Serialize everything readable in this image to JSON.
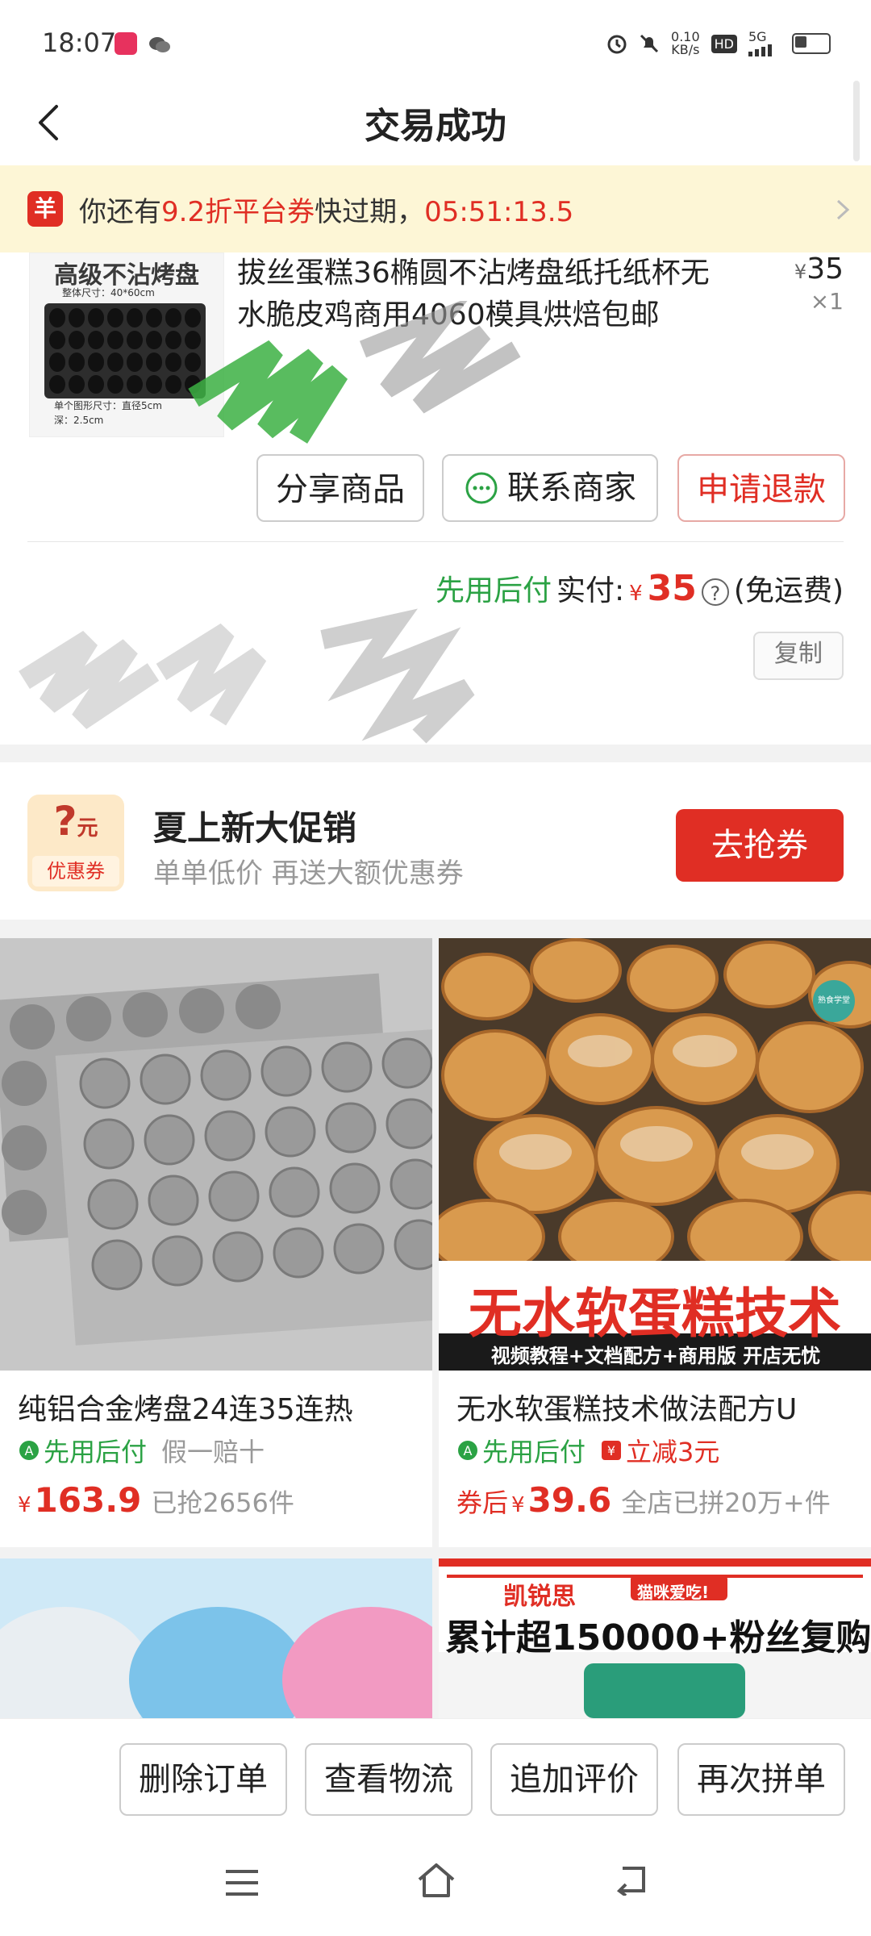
{
  "status_bar": {
    "time": "18:07",
    "net_speed": "0.10",
    "net_unit": "KB/s",
    "hd": "HD",
    "signal": "5G"
  },
  "header": {
    "title": "交易成功"
  },
  "coupon_banner": {
    "badge": "羊",
    "pre": "你还有",
    "highlight": "9.2折平台券",
    "mid": "快过期，",
    "countdown": "05:51:13.5"
  },
  "order": {
    "thumb_title": "高级不沾烤盘",
    "thumb_size": "整体尺寸：40*60cm",
    "thumb_dim1": "单个图形尺寸：直径5cm",
    "thumb_dim2": "深：2.5cm",
    "product_name": "拔丝蛋糕36椭圆不沾烤盘纸托纸杯无水脆皮鸡商用4060模具烘焙包邮",
    "price_symbol": "¥",
    "price": "35",
    "quantity": "×1",
    "buttons": {
      "share": "分享商品",
      "contact": "联系商家",
      "refund": "申请退款"
    },
    "pay_tag": "先用后付",
    "paid_label": "实付:",
    "paid_symbol": "¥",
    "paid_amount": "35",
    "shipping": "(免运费)",
    "copy": "复制"
  },
  "promo": {
    "icon_q": "?",
    "icon_unit": "元",
    "icon_label": "优惠券",
    "title": "夏上新大促销",
    "subtitle": "单单低价 再送大额优惠券",
    "button": "去抢券"
  },
  "products": [
    {
      "name": "纯铝合金烤盘24连35连热",
      "tag1": "先用后付",
      "tag2": "假一赔十",
      "price_prefix": "",
      "price_symbol": "¥",
      "price": "163.9",
      "sold": "已抢2656件"
    },
    {
      "name": "无水软蛋糕技术做法配方U",
      "tag1": "先用后付",
      "tag2": "立减3元",
      "price_prefix": "券后",
      "price_symbol": "¥",
      "price": "39.6",
      "sold": "全店已拼20万+件",
      "image_text": "无水软蛋糕技术",
      "image_subtext": "视频教程+文档配方+商用版 开店无忧",
      "image_badge": "熟食学堂"
    },
    {
      "name": "",
      "image_text": ""
    },
    {
      "name": "",
      "image_brand": "凯锐思",
      "image_tag": "猫咪爱吃!",
      "image_text": "累计超150000+粉丝复购"
    }
  ],
  "bottom_actions": [
    "删除订单",
    "查看物流",
    "追加评价",
    "再次拼单"
  ],
  "colors": {
    "accent": "#e02e24",
    "green": "#2ba244",
    "banner_bg": "#fdf6d6"
  }
}
